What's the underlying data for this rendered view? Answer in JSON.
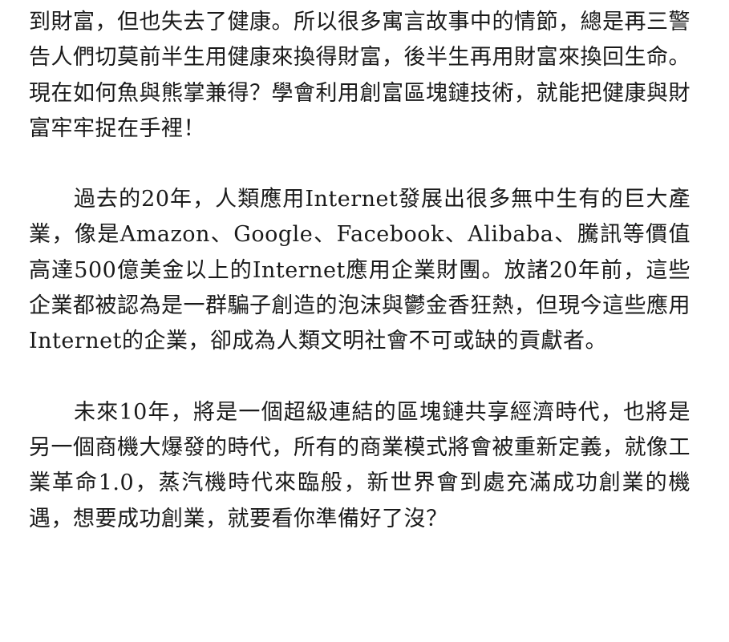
{
  "document": {
    "paragraphs": [
      "到財富，但也失去了健康。所以很多寓言故事中的情節，總是再三警告人們切莫前半生用健康來換得財富，後半生再用財富來換回生命。現在如何魚與熊掌兼得？學會利用創富區塊鏈技術，就能把健康與財富牢牢捉在手裡！",
      "過去的20年，人類應用Internet發展出很多無中生有的巨大產業，像是Amazon、Google、Facebook、Alibaba、騰訊等價值高達500億美金以上的Internet應用企業財團。放諸20年前，這些企業都被認為是一群騙子創造的泡沫與鬱金香狂熱，但現今這些應用Internet的企業，卻成為人類文明社會不可或缺的貢獻者。",
      "未來10年，將是一個超級連結的區塊鏈共享經濟時代，也將是另一個商機大爆發的時代，所有的商業模式將會被重新定義，就像工業革命1.0，蒸汽機時代來臨般，新世界會到處充滿成功創業的機遇，想要成功創業，就要看你準備好了沒？"
    ]
  }
}
